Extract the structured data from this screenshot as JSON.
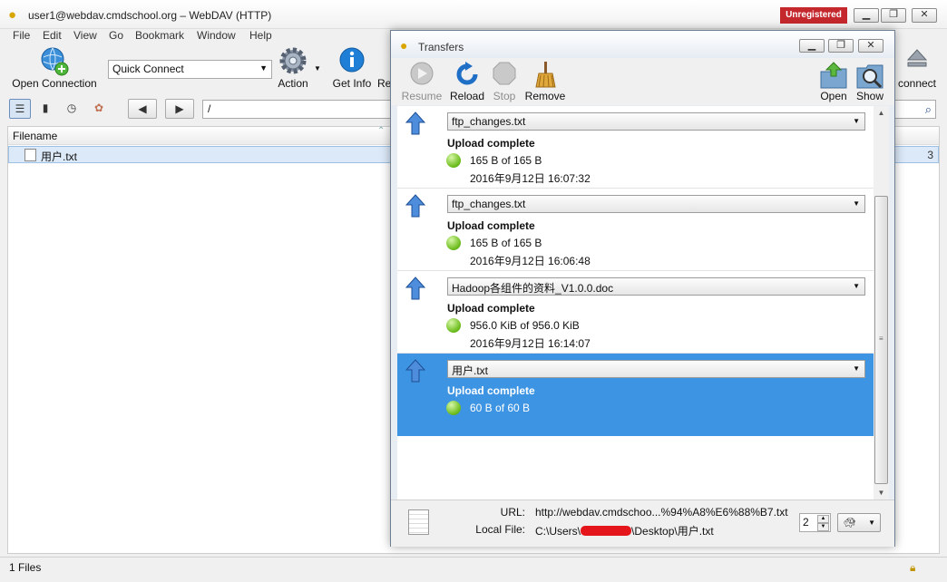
{
  "window": {
    "title": "user1@webdav.cmdschool.org – WebDAV (HTTP)",
    "unregistered": "Unregistered",
    "controls": [
      "▁",
      "❐",
      "✕"
    ]
  },
  "menu": [
    "File",
    "Edit",
    "View",
    "Go",
    "Bookmark",
    "Window",
    "Help"
  ],
  "toolbar": {
    "open_connection": "Open Connection",
    "quick_connect": "Quick Connect",
    "action": "Action",
    "get_info": "Get Info",
    "refresh_partial": "Re",
    "disconnect_partial": "connect"
  },
  "nav": {
    "back": "◀",
    "forward": "▶",
    "path": "/"
  },
  "file_list": {
    "column_filename": "Filename",
    "rows": [
      {
        "name": "用户.txt",
        "tail": "3"
      }
    ]
  },
  "status": {
    "text": "1 Files"
  },
  "transfers": {
    "title": "Transfers",
    "toolbar": {
      "resume": "Resume",
      "reload": "Reload",
      "stop": "Stop",
      "remove": "Remove",
      "open": "Open",
      "show": "Show"
    },
    "items": [
      {
        "name": "ftp_changes.txt",
        "status": "Upload complete",
        "size": "165 B of 165 B",
        "date": "2016年9月12日 16:07:32"
      },
      {
        "name": "ftp_changes.txt",
        "status": "Upload complete",
        "size": "165 B of 165 B",
        "date": "2016年9月12日 16:06:48"
      },
      {
        "name": "Hadoop各组件的资料_V1.0.0.doc",
        "status": "Upload complete",
        "size": "956.0 KiB of 956.0 KiB",
        "date": "2016年9月12日 16:14:07"
      },
      {
        "name": "用户.txt",
        "status": "Upload complete",
        "size": "60 B of 60 B",
        "date": ""
      }
    ],
    "footer": {
      "url_label": "URL:",
      "url_value": "http://webdav.cmdschoo...%94%A8%E6%88%B7.txt",
      "local_label": "Local File:",
      "local_prefix": "C:\\Users\\",
      "local_suffix": "\\Desktop\\用户.txt",
      "connections": "2"
    },
    "colors": {
      "selected_row": "#3d94e2",
      "complete_dot": "#6fbe20"
    }
  }
}
